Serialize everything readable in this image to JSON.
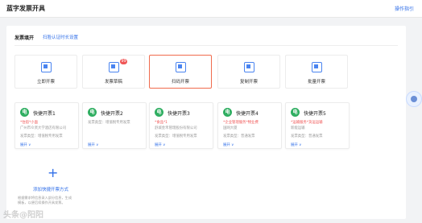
{
  "header": {
    "title": "蓝字发票开具",
    "guide_link": "操作指引"
  },
  "section": {
    "title": "发票填开",
    "link": "扫脸认证时长设置"
  },
  "tiles": [
    {
      "label": "立即开票",
      "icon": "invoice-icon"
    },
    {
      "label": "发票草稿",
      "icon": "draft-icon",
      "badge": "99"
    },
    {
      "label": "扫码开票",
      "icon": "qrcode-icon",
      "active": true
    },
    {
      "label": "复制开票",
      "icon": "copy-icon"
    },
    {
      "label": "批量开票",
      "icon": "batch-icon"
    }
  ],
  "quick_cards": [
    {
      "icon_text": "电",
      "name": "快捷开票1",
      "sub1": "*住宿*小面",
      "sub2": "广州市众贤大学酒店有限公司",
      "sub3": "发票类型：增值税专用发票",
      "expand": "展开 ∨"
    },
    {
      "icon_text": "电",
      "name": "快捷开票2",
      "sub1": "发票类型：增值税专用发票",
      "sub2": "",
      "sub3": "",
      "expand": "展开 ∨"
    },
    {
      "icon_text": "电",
      "name": "快捷开票3",
      "sub1": "*食品*1",
      "sub2": "舒城金禾管理股份有限公司",
      "sub3": "发票类型：增值税专用发票",
      "expand": "展开 ∨"
    },
    {
      "icon_text": "电",
      "name": "快捷开票4",
      "sub1": "*企业管理服务*物业费",
      "sub2": "国网大厦",
      "sub3": "发票类型：普通发票",
      "expand": "展开 ∨"
    },
    {
      "icon_text": "电",
      "name": "快捷开票5",
      "sub1": "*运输服务*货运运输",
      "sub2": "新能运输",
      "sub3": "发票类型：普通发票",
      "expand": "展开 ∨"
    }
  ],
  "add_quick": {
    "label": "添加快捷开票方式",
    "desc": "根据需求将信息录入部分信息，生成模板，以便后续操作开具发票。"
  },
  "watermark": "头条@阳阳"
}
